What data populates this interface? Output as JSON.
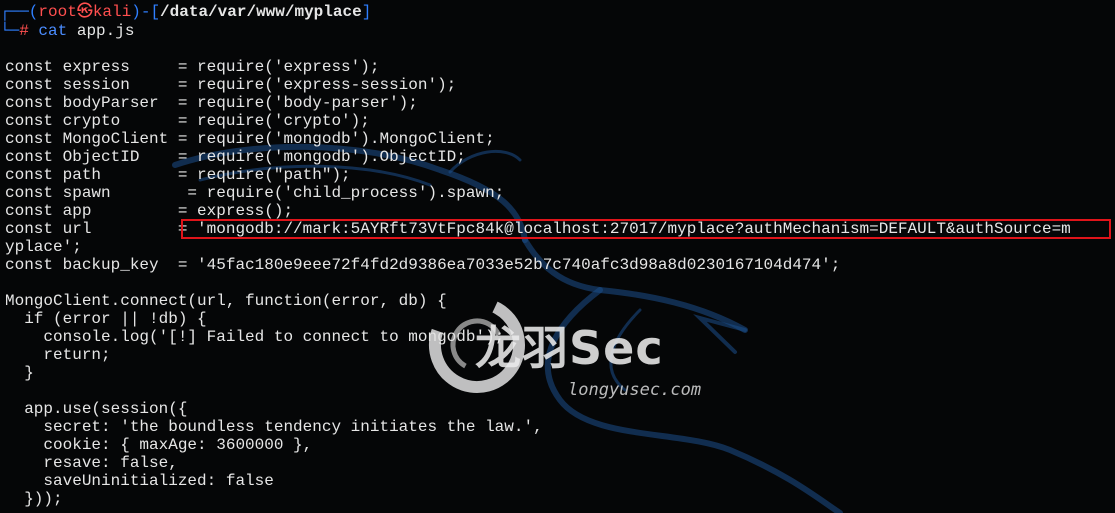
{
  "prompt": {
    "prefix": "┌──(",
    "user": "root",
    "skull": "㉿",
    "host": "kali",
    "mid": ")-[",
    "path": "/data/var/www/myplace",
    "suffix": "]",
    "line2_prefix": "└─",
    "hash": "#",
    "command": "cat",
    "argument": "app.js"
  },
  "code_lines": [
    "const express     = require('express');",
    "const session     = require('express-session');",
    "const bodyParser  = require('body-parser');",
    "const crypto      = require('crypto');",
    "const MongoClient = require('mongodb').MongoClient;",
    "const ObjectID    = require('mongodb').ObjectID;",
    "const path        = require(\"path\");",
    "const spawn        = require('child_process').spawn;",
    "const app         = express();",
    "const url         = 'mongodb://mark:5AYRft73VtFpc84k@localhost:27017/myplace?authMechanism=DEFAULT&authSource=m",
    "yplace';",
    "const backup_key  = '45fac180e9eee72f4fd2d9386ea7033e52b7c740afc3d98a8d0230167104d474';",
    "",
    "MongoClient.connect(url, function(error, db) {",
    "  if (error || !db) {",
    "    console.log('[!] Failed to connect to mongodb');",
    "    return;",
    "  }",
    "",
    "  app.use(session({",
    "    secret: 'the boundless tendency initiates the law.',",
    "    cookie: { maxAge: 3600000 },",
    "    resave: false,",
    "    saveUninitialized: false",
    "  }));"
  ],
  "watermark": {
    "brand": "龙羽Sec",
    "url": "longyusec.com"
  },
  "colors": {
    "background": "#050607",
    "prompt_blue": "#2f7fff",
    "prompt_red": "#ff4f4f",
    "highlight_border": "#e0141a",
    "text": "#e6e6e6"
  }
}
